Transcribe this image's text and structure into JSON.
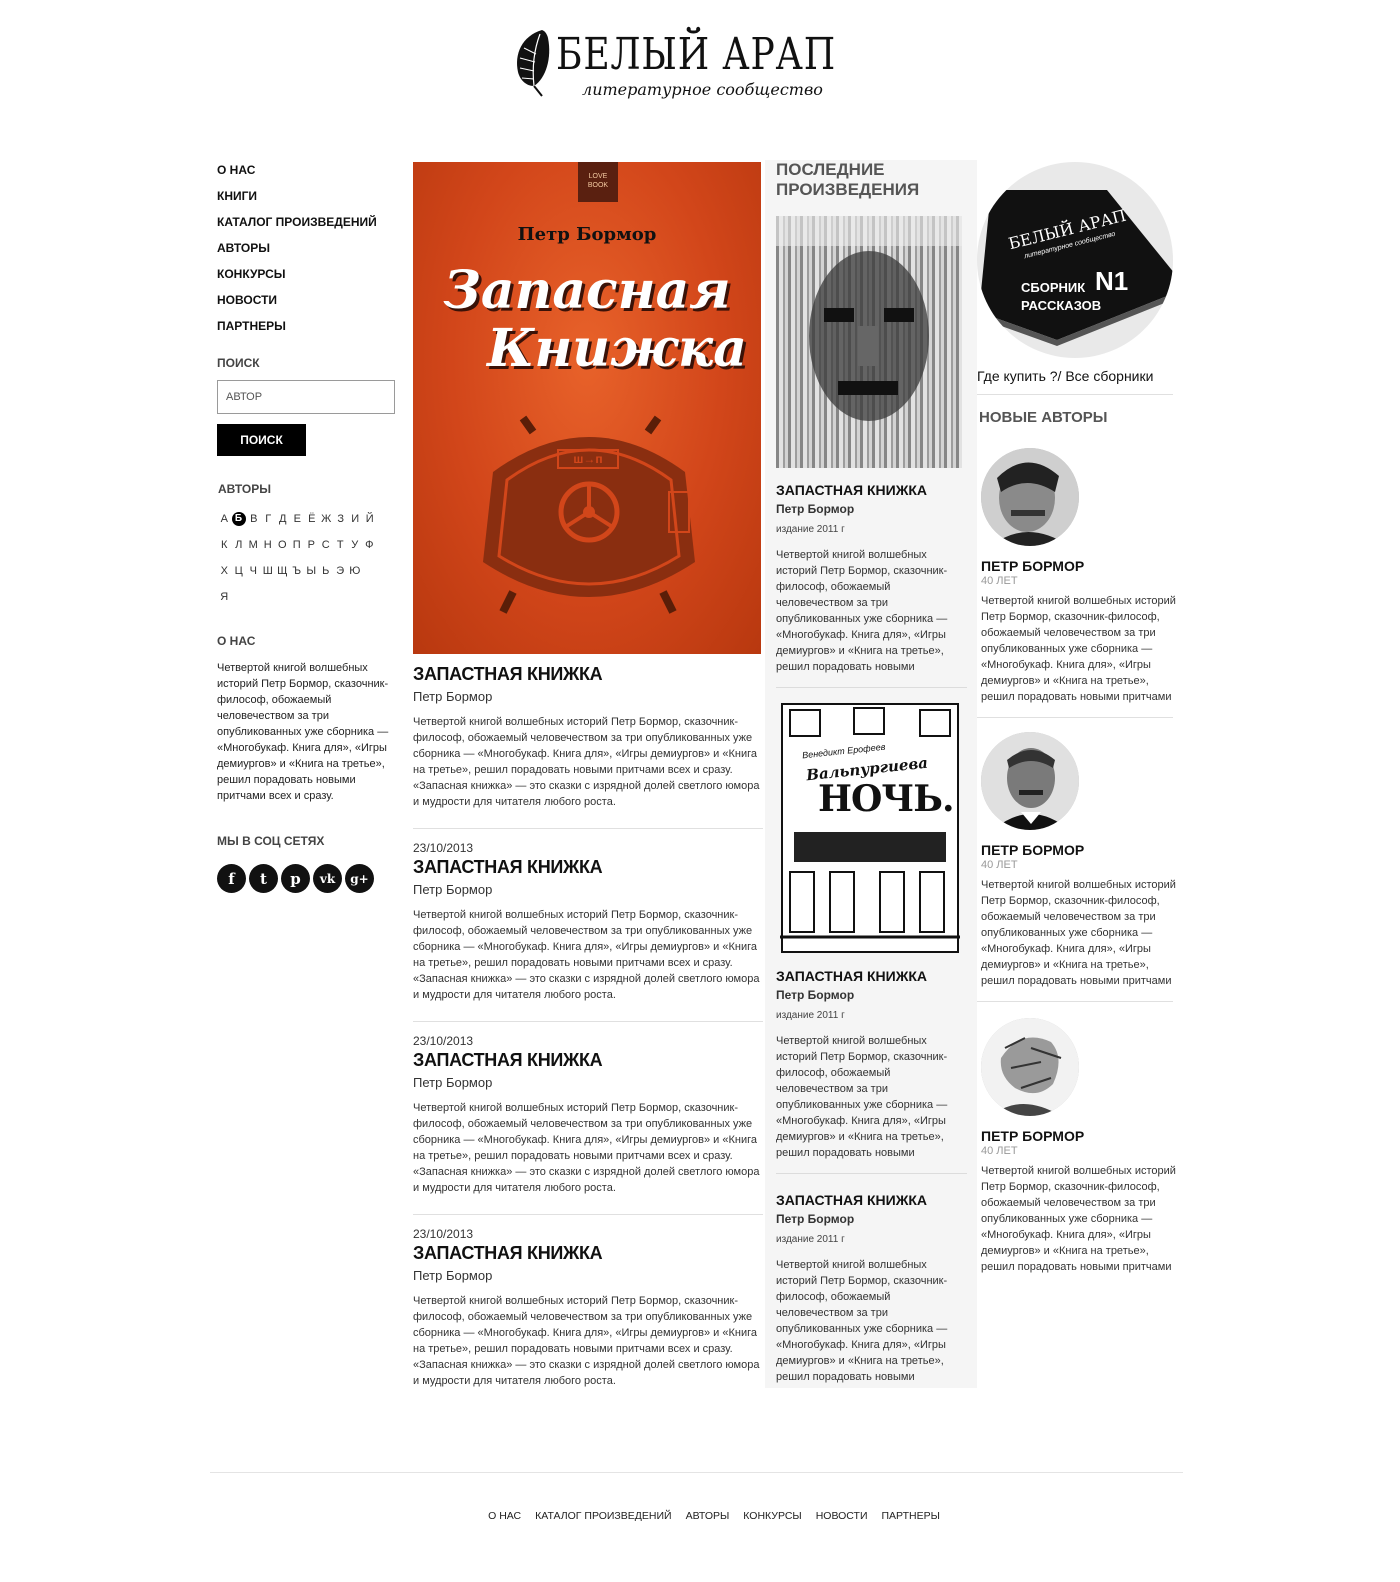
{
  "brand": {
    "name": "БЕЛЫЙ АРАП",
    "tagline": "литературное сообщество"
  },
  "menu": [
    "О НАС",
    "КНИГИ",
    "КАТАЛОГ ПРОИЗВЕДЕНИЙ",
    "АВТОРЫ",
    "КОНКУРСЫ",
    "НОВОСТИ",
    "ПАРТНЕРЫ"
  ],
  "search": {
    "heading": "ПОИСК",
    "value": "АВТОР",
    "button": "ПОИСК"
  },
  "authors_index": {
    "heading": "АВТОРЫ",
    "active": "Б",
    "rows": [
      [
        "А",
        "Б",
        "В",
        "Г",
        "Д",
        "Е",
        "Ё",
        "Ж",
        "З",
        "И",
        "Й"
      ],
      [
        "К",
        "Л",
        "М",
        "Н",
        "О",
        "П",
        "Р",
        "С",
        "Т",
        "У",
        "Ф"
      ],
      [
        "Х",
        "Ц",
        "Ч",
        "Ш",
        "Щ",
        "Ъ",
        "Ы",
        "Ь",
        "Э",
        "Ю"
      ],
      [
        "Я"
      ]
    ]
  },
  "about": {
    "heading": "О НАС",
    "text": "Четвертой книгой волшебных историй Петр Бормор, сказочник-философ, обожаемый человечеством за три опубликованных уже сборника — «Многобукаф. Книга для», «Игры демиургов» и «Книга на третье», решил порадовать новыми притчами всех и сразу."
  },
  "social": {
    "heading": "МЫ В СОЦ СЕТЯХ",
    "icons": [
      {
        "name": "facebook-icon",
        "glyph": "f"
      },
      {
        "name": "twitter-icon",
        "glyph": "t"
      },
      {
        "name": "pinterest-icon",
        "glyph": "p"
      },
      {
        "name": "vk-icon",
        "glyph": "vk"
      },
      {
        "name": "google-plus-icon",
        "glyph": "g+"
      }
    ]
  },
  "featured": {
    "cover": {
      "badge": "LOVE BOOK",
      "author": "Петр Бормор",
      "title_line1": "Запасная",
      "title_line2": "Книжка",
      "sign": "ш→п"
    },
    "title": "ЗАПАСТНАЯ КНИЖКА",
    "author": "Петр Бормор",
    "desc1": "Четвертой книгой волшебных историй Петр Бормор, сказочник-философ, обожаемый человечеством за три опубликованных уже сборника — «Многобукаф. Книга для», «Игры демиургов» и «Книга на третье», решил порадовать новыми притчами всех и сразу.",
    "desc2": "«Запасная книжка» — это сказки с изрядной долей светлого юмора и мудрости для читателя любого роста."
  },
  "articles": [
    {
      "date": "23/10/2013",
      "title": "ЗАПАСТНАЯ КНИЖКА",
      "author": "Петр Бормор",
      "desc1": "Четвертой книгой волшебных историй Петр Бормор, сказочник-философ, обожаемый человечеством за три опубликованных уже сборника — «Многобукаф. Книга для», «Игры демиургов» и «Книга на третье», решил порадовать новыми притчами всех и сразу.",
      "desc2": "«Запасная книжка» — это сказки с изрядной долей светлого юмора и мудрости для читателя любого роста."
    },
    {
      "date": "23/10/2013",
      "title": "ЗАПАСТНАЯ КНИЖКА",
      "author": "Петр Бормор",
      "desc1": "Четвертой книгой волшебных историй Петр Бормор, сказочник-философ, обожаемый человечеством за три опубликованных уже сборника — «Многобукаф. Книга для», «Игры демиургов» и «Книга на третье», решил порадовать новыми притчами всех и сразу.",
      "desc2": "«Запасная книжка» — это сказки с изрядной долей светлого юмора и мудрости для читателя любого роста."
    },
    {
      "date": "23/10/2013",
      "title": "ЗАПАСТНАЯ КНИЖКА",
      "author": "Петр Бормор",
      "desc1": "Четвертой книгой волшебных историй Петр Бормор, сказочник-философ, обожаемый человечеством за три опубликованных уже сборника — «Многобукаф. Книга для», «Игры демиургов» и «Книга на третье», решил порадовать новыми притчами всех и сразу.",
      "desc2": "«Запасная книжка» — это сказки с изрядной долей светлого юмора и мудрости для читателя любого роста."
    }
  ],
  "recent": {
    "heading": "ПОСЛЕДНИЕ ПРОИЗВЕДЕНИЯ",
    "items": [
      {
        "title": "ЗАПАСТНАЯ КНИЖКА",
        "author": "Петр Бормор",
        "edition": "издание 2011 г",
        "desc": "Четвертой книгой волшебных историй Петр Бормор, сказочник-философ, обожаемый человечеством за три опубликованных уже сборника — «Многобукаф. Книга для», «Игры демиургов» и «Книга на третье», решил порадовать новыми"
      },
      {
        "cover_author": "Венедикт Ерофеев",
        "cover_title1": "Вальпургиева",
        "cover_title2": "НОЧЬ.",
        "title": "ЗАПАСТНАЯ КНИЖКА",
        "author": "Петр Бормор",
        "edition": "издание 2011 г",
        "desc": "Четвертой книгой волшебных историй Петр Бормор, сказочник-философ, обожаемый человечеством за три опубликованных уже сборника — «Многобукаф. Книга для», «Игры демиургов» и «Книга на третье», решил порадовать новыми"
      },
      {
        "title": "ЗАПАСТНАЯ КНИЖКА",
        "author": "Петр Бормор",
        "edition": "издание 2011 г",
        "desc": "Четвертой книгой волшебных историй Петр Бормор, сказочник-философ, обожаемый человечеством за три опубликованных уже сборника — «Многобукаф. Книга для», «Игры демиургов» и «Книга на третье», решил порадовать новыми"
      }
    ]
  },
  "promo": {
    "book_brand": "БЕЛЫЙ АРАП",
    "book_tagline": "литературное сообщество",
    "book_line1": "СБОРНИК",
    "book_number": "N1",
    "book_line2": "РАССКАЗОВ",
    "links": "Где купить ?/ Все сборники"
  },
  "new_authors": {
    "heading": "НОВЫЕ АВТОРЫ",
    "items": [
      {
        "name": "ПЕТР БОРМОР",
        "age": "40 ЛЕТ",
        "desc": "Четвертой книгой волшебных историй Петр Бормор, сказочник-философ, обожаемый человечеством за три опубликованных уже сборника — «Многобукаф. Книга для», «Игры демиургов» и «Книга на третье», решил порадовать новыми притчами"
      },
      {
        "name": "ПЕТР БОРМОР",
        "age": "40 ЛЕТ",
        "desc": "Четвертой книгой волшебных историй Петр Бормор, сказочник-философ, обожаемый человечеством за три опубликованных уже сборника — «Многобукаф. Книга для», «Игры демиургов» и «Книга на третье», решил порадовать новыми притчами"
      },
      {
        "name": "ПЕТР БОРМОР",
        "age": "40 ЛЕТ",
        "desc": "Четвертой книгой волшебных историй Петр Бормор, сказочник-философ, обожаемый человечеством за три опубликованных уже сборника — «Многобукаф. Книга для», «Игры демиургов» и «Книга на третье», решил порадовать новыми притчами"
      }
    ]
  },
  "footer": [
    "О НАС",
    "КАТАЛОГ ПРОИЗВЕДЕНИЙ",
    "АВТОРЫ",
    "КОНКУРСЫ",
    "НОВОСТИ",
    "ПАРТНЕРЫ"
  ],
  "colors": {
    "accent": "#000000",
    "cover_orange": "#d2461a",
    "panel_bg": "#f5f5f5"
  }
}
